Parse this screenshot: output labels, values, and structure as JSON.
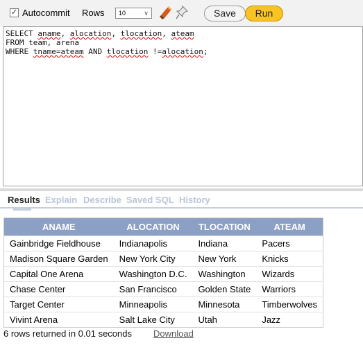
{
  "toolbar": {
    "autocommit_label": "Autocommit",
    "autocommit_checked": true,
    "rows_label": "Rows",
    "rows_value": "10",
    "save_label": "Save",
    "run_label": "Run",
    "run_color": "#f9c423"
  },
  "editor": {
    "lines": [
      "SELECT aname, alocation, tlocation, ateam",
      "FROM team, arena",
      "WHERE tname=ateam AND tlocation !=alocation;"
    ]
  },
  "tabs": [
    {
      "label": "Results",
      "active": true
    },
    {
      "label": "Explain",
      "active": false
    },
    {
      "label": "Describe",
      "active": false
    },
    {
      "label": "Saved SQL",
      "active": false
    },
    {
      "label": "History",
      "active": false
    }
  ],
  "results": {
    "headers": [
      "ANAME",
      "ALOCATION",
      "TLOCATION",
      "ATEAM"
    ],
    "header_color": "#8c9fc4",
    "rows": [
      [
        "Gainbridge Fieldhouse",
        "Indianapolis",
        "Indiana",
        "Pacers"
      ],
      [
        "Madison Square Garden",
        "New York City",
        "New York",
        "Knicks"
      ],
      [
        "Capital One Arena",
        "Washington D.C.",
        "Washington",
        "Wizards"
      ],
      [
        "Chase Center",
        "San Francisco",
        "Golden State",
        "Warriors"
      ],
      [
        "Target Center",
        "Minneapolis",
        "Minnesota",
        "Timberwolves"
      ],
      [
        "Vivint Arena",
        "Salt Lake City",
        "Utah",
        "Jazz"
      ]
    ]
  },
  "footer": {
    "status": "6 rows returned in 0.01 seconds",
    "download_label": "Download"
  }
}
